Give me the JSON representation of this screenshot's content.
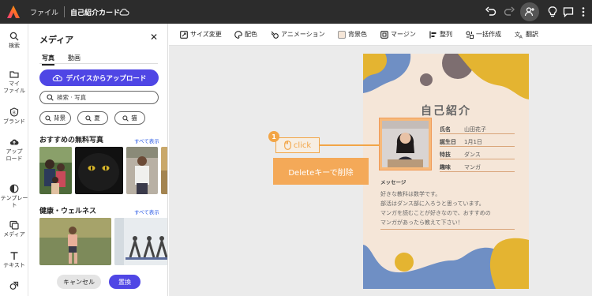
{
  "topbar": {
    "file_menu": "ファイル",
    "doc_title": "自己紹介カード"
  },
  "rail": {
    "items": [
      {
        "label": "検索",
        "icon": "search-icon"
      },
      {
        "label": "マイ\nファイル",
        "icon": "folder-icon"
      },
      {
        "label": "ブランド",
        "icon": "brand-icon"
      },
      {
        "label": "アップ\nロード",
        "icon": "upload-icon"
      },
      {
        "label": "テンプレート",
        "icon": "template-icon"
      },
      {
        "label": "メディア",
        "icon": "media-icon"
      },
      {
        "label": "テキスト",
        "icon": "text-icon"
      }
    ]
  },
  "panel": {
    "title": "メディア",
    "tabs": [
      "写真",
      "動画"
    ],
    "upload_label": "デバイスからアップロード",
    "search_placeholder": "検索 · 写真",
    "chips": [
      "背景",
      "夏",
      "猫"
    ],
    "section1_title": "おすすめの無料写真",
    "section2_title": "健康・ウェルネス",
    "see_all": "すべて表示",
    "cancel_label": "キャンセル",
    "replace_label": "置換"
  },
  "toolbar": {
    "tools": [
      "サイズ変更",
      "配色",
      "アニメーション",
      "背景色",
      "マージン",
      "整列",
      "一括作成",
      "翻訳"
    ]
  },
  "card": {
    "title": "自己紹介",
    "fields": [
      {
        "label": "氏名",
        "value": "山田花子"
      },
      {
        "label": "誕生日",
        "value": "1月1日"
      },
      {
        "label": "特技",
        "value": "ダンス"
      },
      {
        "label": "趣味",
        "value": "マンガ"
      }
    ],
    "message_heading": "メッセージ",
    "message_lines": [
      "好きな教科は数学です。",
      "部活はダンス部に入ろうと思っています。",
      "マンガを読むことが好きなので、おすすめの",
      "マンガがあったら教えて下さい！"
    ]
  },
  "callout": {
    "step_number": "1",
    "click_label": "click",
    "note": "Deleteキーで削除"
  },
  "colors": {
    "topbar_bg": "#2c2c2c",
    "accent": "#4f46e5",
    "callout": "#f2a546",
    "card_bg": "#f5e6d8",
    "blob_blue": "#6f8fc4",
    "blob_yellow": "#e4b431",
    "blob_brown": "#7d6e70"
  }
}
